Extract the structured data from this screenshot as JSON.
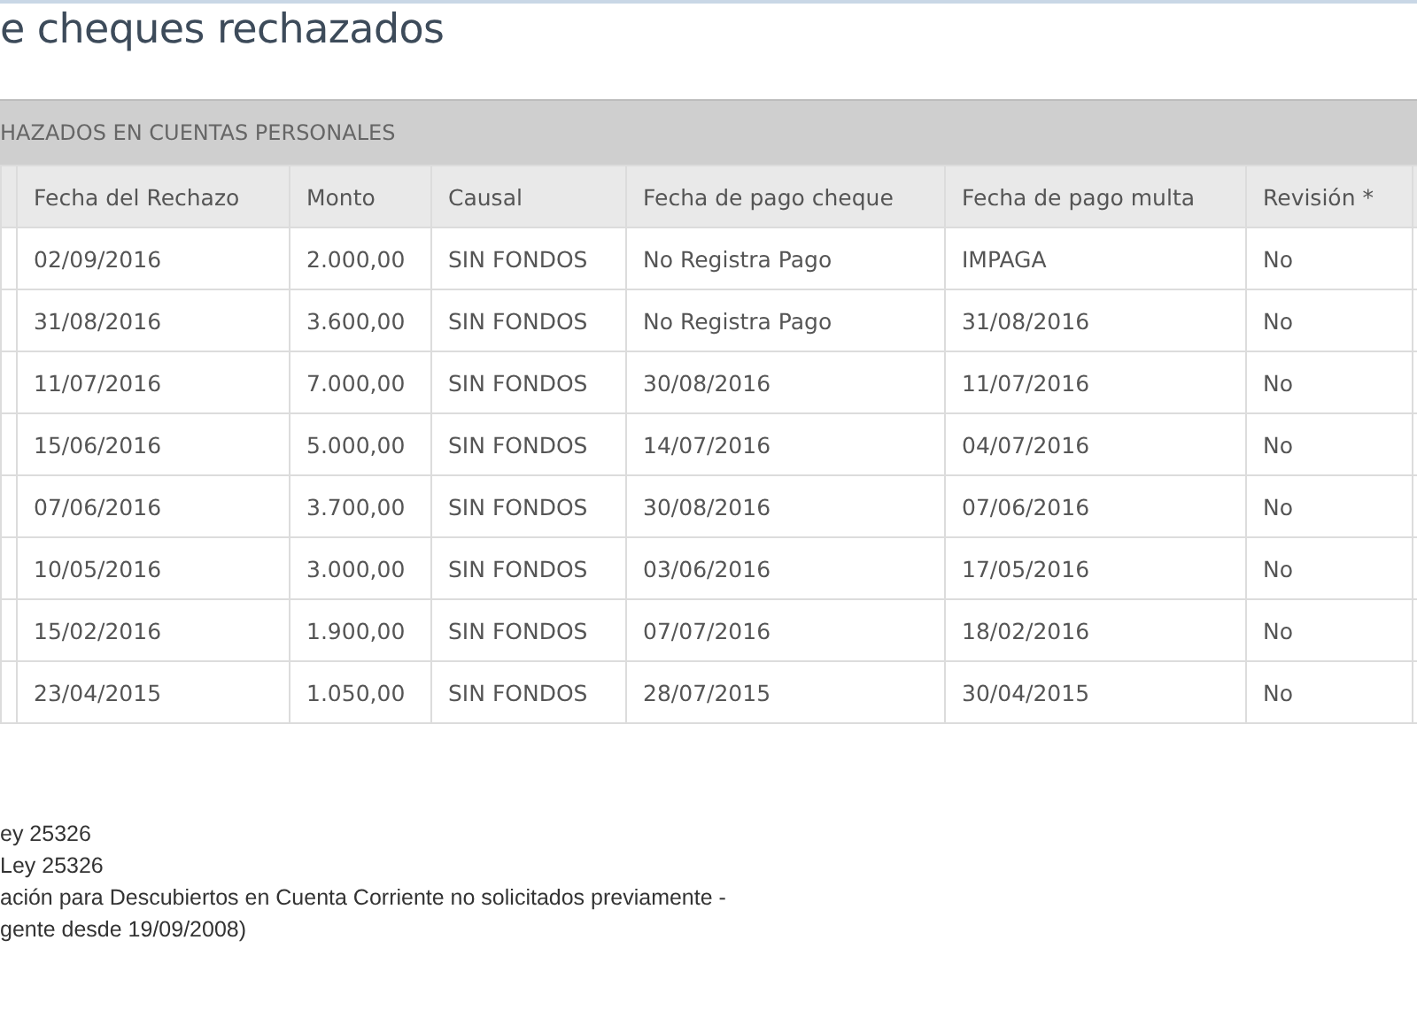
{
  "title": "e cheques rechazados",
  "table": {
    "caption": "HAZADOS EN CUENTAS PERSONALES",
    "columns": [
      "Fecha del Rechazo",
      "Monto",
      "Causal",
      "Fecha de pago cheque",
      "Fecha de pago multa",
      "Revisión *"
    ],
    "rows": [
      [
        "02/09/2016",
        "2.000,00",
        "SIN FONDOS",
        "No Registra Pago",
        "IMPAGA",
        "No"
      ],
      [
        "31/08/2016",
        "3.600,00",
        "SIN FONDOS",
        "No Registra Pago",
        "31/08/2016",
        "No"
      ],
      [
        "11/07/2016",
        "7.000,00",
        "SIN FONDOS",
        "30/08/2016",
        "11/07/2016",
        "No"
      ],
      [
        "15/06/2016",
        "5.000,00",
        "SIN FONDOS",
        "14/07/2016",
        "04/07/2016",
        "No"
      ],
      [
        "07/06/2016",
        "3.700,00",
        "SIN FONDOS",
        "30/08/2016",
        "07/06/2016",
        "No"
      ],
      [
        "10/05/2016",
        "3.000,00",
        "SIN FONDOS",
        "03/06/2016",
        "17/05/2016",
        "No"
      ],
      [
        "15/02/2016",
        "1.900,00",
        "SIN FONDOS",
        "07/07/2016",
        "18/02/2016",
        "No"
      ],
      [
        "23/04/2015",
        "1.050,00",
        "SIN FONDOS",
        "28/07/2015",
        "30/04/2015",
        "No"
      ]
    ]
  },
  "footnotes": [
    "ey 25326",
    "Ley 25326",
    "ación para Descubiertos en Cuenta Corriente no solicitados previamente -",
    "gente desde 19/09/2008)"
  ]
}
